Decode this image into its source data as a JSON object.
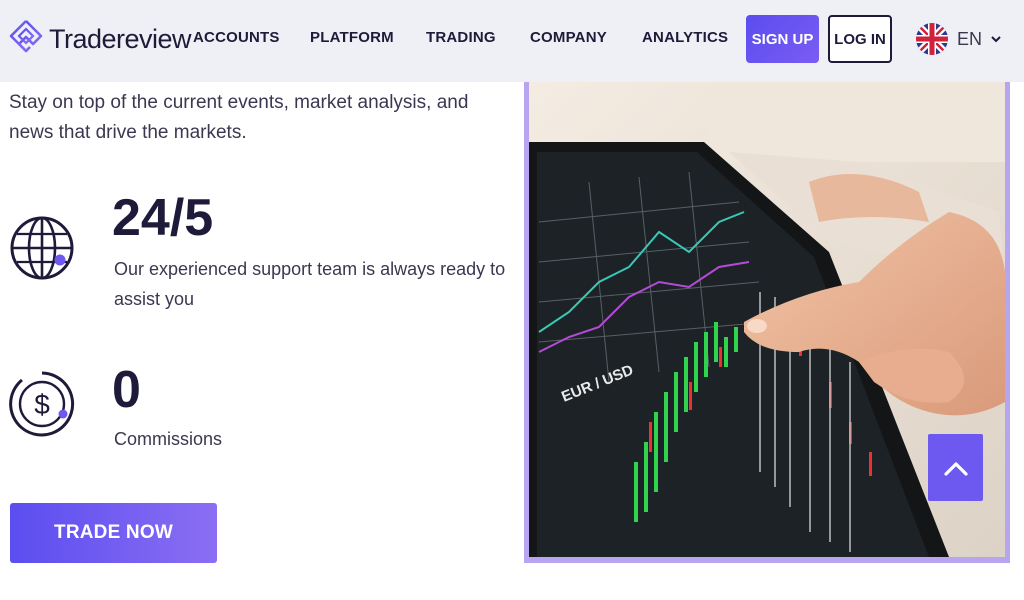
{
  "header": {
    "brand": "Tradereview",
    "nav": [
      "ACCOUNTS",
      "PLATFORM",
      "TRADING",
      "COMPANY",
      "ANALYTICS"
    ],
    "signup_label": "SIGN UP",
    "login_label": "LOG IN",
    "language": "EN"
  },
  "main": {
    "intro": "Stay on top of the current events, market analysis, and news that drive the markets.",
    "features": [
      {
        "value": "24/5",
        "description": "Our experienced support team is always ready to assist you"
      },
      {
        "value": "0",
        "description": "Commissions"
      }
    ],
    "cta_label": "TRADE NOW"
  },
  "hero": {
    "chart_label": "EUR / USD"
  },
  "colors": {
    "accent": "#5b4df0",
    "accent_light": "#8b6ef3",
    "text_dark": "#1e1b3a",
    "frame": "#b7a5f0",
    "header_bg": "#eef0f5"
  },
  "icons": [
    "tradereview-logo-icon",
    "uk-flag-icon",
    "chevron-down-icon",
    "globe-icon",
    "dollar-coin-icon",
    "arrow-up-icon"
  ]
}
